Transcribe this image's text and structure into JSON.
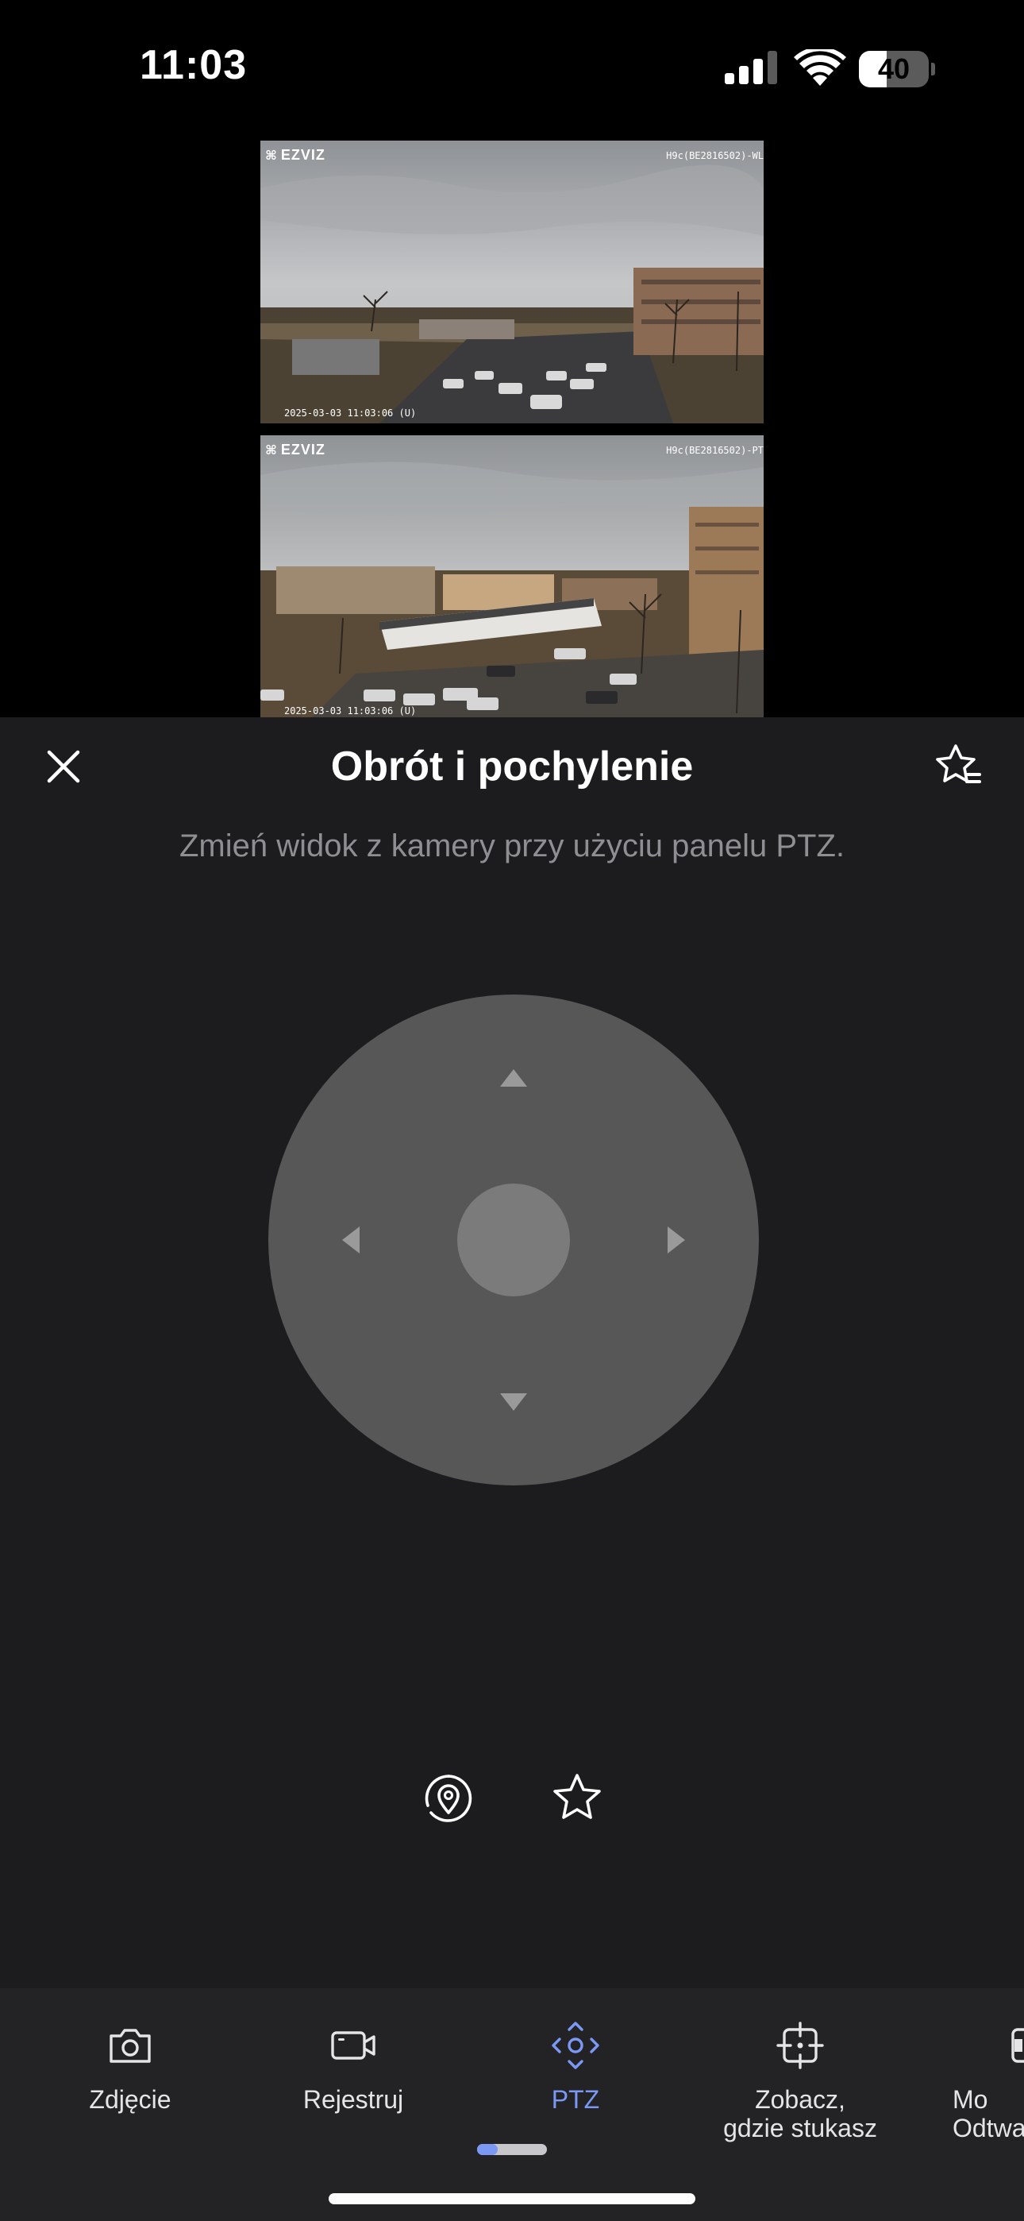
{
  "status_bar": {
    "time": "11:03",
    "battery_level": "40",
    "battery_fraction": 0.4,
    "icons": [
      "signal-icon",
      "wifi-icon",
      "battery-icon"
    ]
  },
  "feeds": [
    {
      "logo": "EZVIZ",
      "camera_name": "H9c(BE2816502)-WL",
      "timestamp": "2025-03-03 11:03:06 (U)"
    },
    {
      "logo": "EZVIZ",
      "camera_name": "H9c(BE2816502)-PT",
      "timestamp": "2025-03-03 11:03:06 (U)"
    }
  ],
  "ptz_panel": {
    "title": "Obrót i pochylenie",
    "subtitle": "Zmień widok z kamery przy użyciu panelu PTZ.",
    "close_icon": "close-icon",
    "favorites_icon": "star-list-icon",
    "joystick_arrows": [
      "arrow-up-icon",
      "arrow-down-icon",
      "arrow-left-icon",
      "arrow-right-icon"
    ],
    "preset_icons": [
      "location-preset-icon",
      "star-icon"
    ]
  },
  "toolbar": {
    "items": [
      {
        "label": "Zdjęcie",
        "icon": "camera-icon",
        "active": false
      },
      {
        "label": "Rejestruj",
        "icon": "video-camera-icon",
        "active": false
      },
      {
        "label": "PTZ",
        "icon": "ptz-icon",
        "active": true
      },
      {
        "label": "Zobacz,\ngdzie stukasz",
        "icon": "crosshair-icon",
        "active": false
      },
      {
        "label": "Mo\nOdtwa",
        "icon": "playback-icon",
        "active": false
      }
    ],
    "accent_color": "#7b98f5"
  },
  "colors": {
    "panel_background": "#1c1c1e",
    "toolbar_background": "#232325",
    "joystick": "#575757",
    "joystick_center": "#7b7b7b",
    "subtitle": "#8e8e93"
  }
}
